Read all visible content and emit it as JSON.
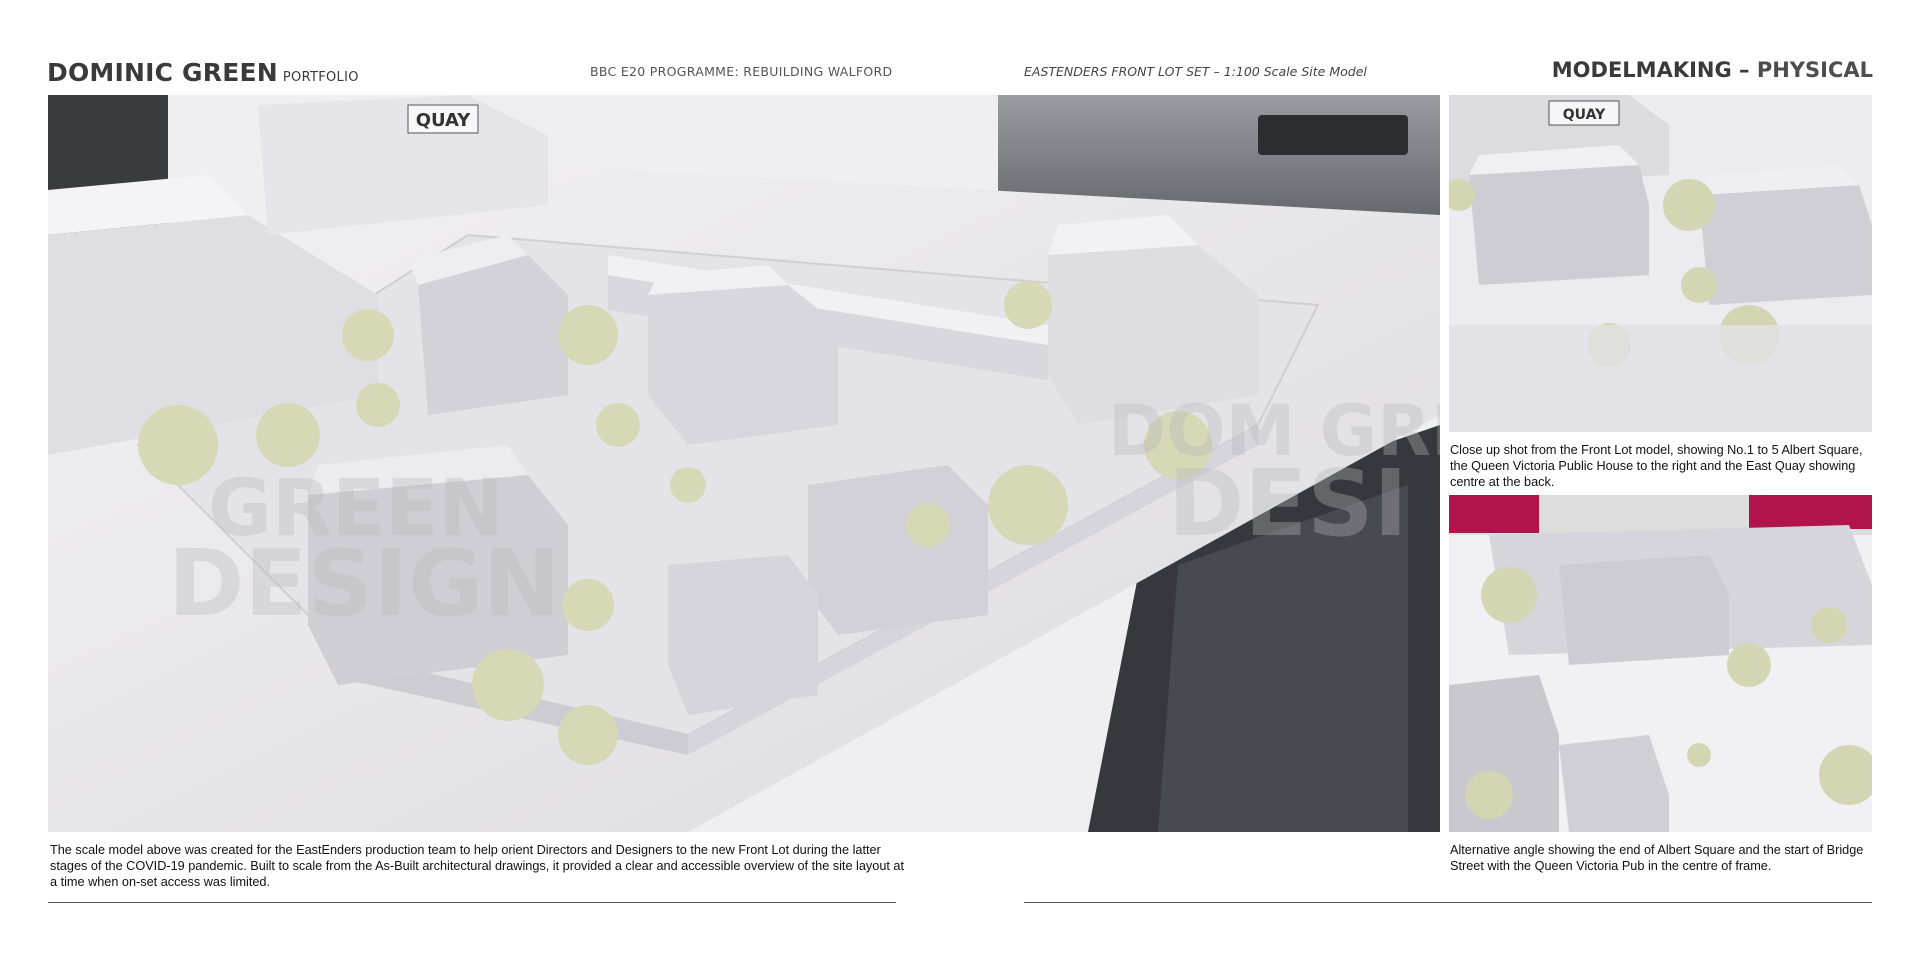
{
  "header": {
    "brand_name": "DOMINIC GREEN",
    "brand_sub": "PORTFOLIO",
    "programme": "BBC E20 PROGRAMME: REBUILDING WALFORD",
    "set_title": "EASTENDERS FRONT LOT SET – 1:100 Scale Site Model",
    "section_prefix": "MODELMAKING – ",
    "section_main": "PHYSICAL"
  },
  "photos": {
    "main_sign": "QUAY",
    "side_sign": "QUAY",
    "watermark_top": "GREEN",
    "watermark_bottom": "DESIGN",
    "watermark_top_2": "DOM GREEN",
    "watermark_bottom_2": "DESI"
  },
  "captions": {
    "main": "The scale model above was created for the EastEnders production team to help orient Directors and Designers to the new Front Lot during the latter stages of the COVID-19 pandemic. Built to scale from the As-Built architectural drawings, it provided a clear and accessible overview of the site layout at a time when on-set access was limited.",
    "side_1": "Close up shot from the Front Lot model, showing No.1 to 5 Albert Square, the Queen Victoria Public House to the right and the East Quay showing centre at the back.",
    "side_2": "Alternative angle showing the end of Albert Square and the start of Bridge Street with the Queen Victoria Pub in the centre of frame."
  },
  "colors": {
    "model_white": "#e9e8ec",
    "tree_green": "#d3d5b3",
    "magenta_accent": "#b0144a",
    "desk_dark": "#3b3d42"
  }
}
